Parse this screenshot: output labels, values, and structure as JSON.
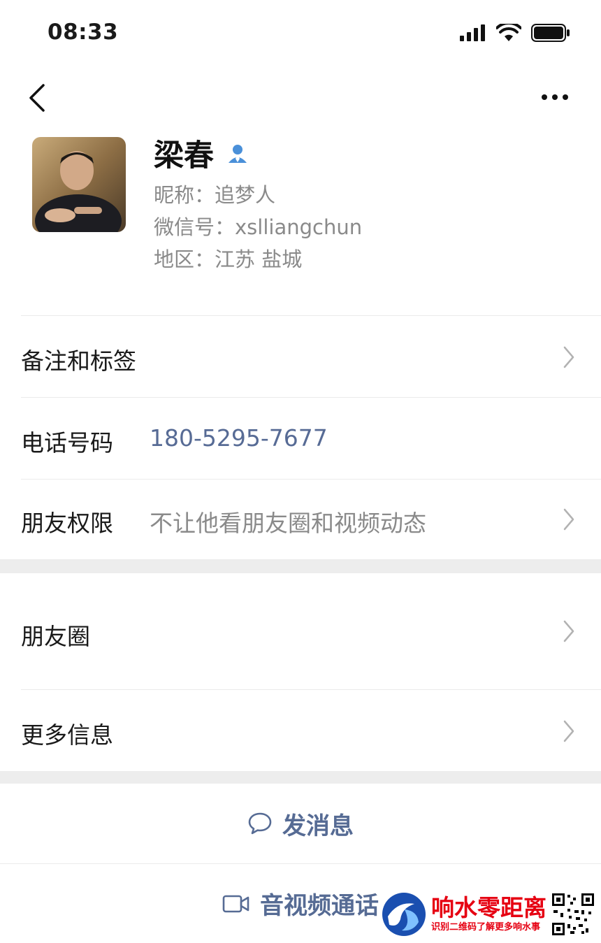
{
  "status_bar": {
    "time": "08:33"
  },
  "profile": {
    "name": "梁春",
    "nickname": "昵称：追梦人",
    "wechat_id": "微信号：xslliangchun",
    "region": "地区：江苏 盐城"
  },
  "rows": {
    "remarks_label": "备注和标签",
    "phone_label": "电话号码",
    "phone_value": "180-5295-7677",
    "permission_label": "朋友权限",
    "permission_value": "不让他看朋友圈和视频动态",
    "moments_label": "朋友圈",
    "more_info_label": "更多信息"
  },
  "actions": {
    "send_message": "发消息",
    "video_call": "音视频通话"
  },
  "watermark": {
    "title": "响水零距离",
    "subtitle": "识别二维码了解更多响水事"
  },
  "colors": {
    "link_blue": "#566b94",
    "phone_blue": "#576b95",
    "section_gap": "#ededed",
    "watermark_red": "#e60012"
  }
}
